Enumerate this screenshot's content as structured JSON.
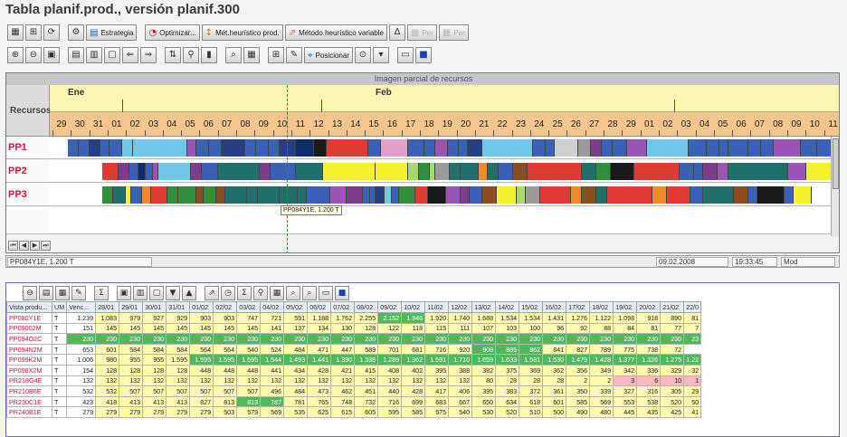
{
  "title": "Tabla planif.prod., versión planif.300",
  "toolbar1": {
    "estrategia": "Estrategia",
    "optimizar": "Optimizar...",
    "met_heur_prod": "Mét.heurístico prod.",
    "metodo_heur_var": "Método heurístico variable",
    "per1": "Per",
    "per2": "Per"
  },
  "toolbar2": {
    "posicionar": "Posicionar"
  },
  "gantt": {
    "subtitle": "Imagen parcial de recursos",
    "corner_label": "Recursos",
    "months": [
      "Ene",
      "Feb"
    ],
    "days": [
      "29",
      "30",
      "31",
      "01",
      "02",
      "03",
      "04",
      "05",
      "06",
      "07",
      "08",
      "09",
      "10",
      "11",
      "12",
      "13",
      "14",
      "15",
      "16",
      "17",
      "18",
      "19",
      "20",
      "21",
      "22",
      "23",
      "24",
      "25",
      "26",
      "27",
      "28",
      "29",
      "01",
      "02",
      "03",
      "04",
      "05",
      "06",
      "07",
      "08",
      "09",
      "10",
      "11"
    ],
    "resources": [
      "PP1",
      "PP2",
      "PP3"
    ],
    "tooltip": "PP084Y1E, 1.200 T"
  },
  "status": {
    "left": "PP084Y1E, 1.200 T",
    "date": "09.02.2008",
    "time": "19:33:45",
    "mode": "Mod"
  },
  "table": {
    "headers": [
      "Vista produ...",
      "UM",
      "Venc...",
      "28/01",
      "29/01",
      "30/01",
      "31/01",
      "01/02",
      "02/02",
      "03/02",
      "04/02",
      "05/02",
      "06/02",
      "07/02",
      "08/02",
      "09/02",
      "10/02",
      "11/02",
      "12/02",
      "13/02",
      "14/02",
      "15/02",
      "16/02",
      "17/02",
      "18/02",
      "19/02",
      "20/02",
      "21/02",
      "22/0"
    ],
    "rows": [
      {
        "name": "PP080Y1E",
        "um": "T",
        "v": [
          "1.239",
          "1.083",
          "979",
          "927",
          "929",
          "903",
          "903",
          "747",
          "721",
          "591",
          "1.188",
          "1.762",
          "2.255",
          "2.152",
          "1.946",
          "1.920",
          "1.740",
          "1.688",
          "1.534",
          "1.534",
          "1.431",
          "1.276",
          "1.122",
          "1.098",
          "918",
          "890",
          "81"
        ]
      },
      {
        "name": "PP09002M",
        "um": "T",
        "v": [
          "151",
          "145",
          "145",
          "145",
          "145",
          "145",
          "145",
          "145",
          "141",
          "137",
          "134",
          "130",
          "128",
          "122",
          "118",
          "115",
          "111",
          "107",
          "103",
          "100",
          "96",
          "92",
          "88",
          "84",
          "81",
          "77",
          "7"
        ]
      },
      {
        "name": "PP094O2C",
        "um": "T",
        "v": [
          "230",
          "230",
          "230",
          "230",
          "230",
          "230",
          "230",
          "230",
          "230",
          "230",
          "230",
          "230",
          "230",
          "230",
          "230",
          "230",
          "230",
          "230",
          "230",
          "230",
          "230",
          "230",
          "230",
          "230",
          "230",
          "230",
          "23"
        ]
      },
      {
        "name": "PP094N2M",
        "um": "T",
        "v": [
          "653",
          "601",
          "584",
          "584",
          "584",
          "564",
          "564",
          "540",
          "524",
          "484",
          "471",
          "447",
          "589",
          "701",
          "681",
          "716",
          "920",
          "908",
          "885",
          "862",
          "841",
          "827",
          "789",
          "775",
          "738",
          "72"
        ]
      },
      {
        "name": "PP099K2M",
        "um": "T",
        "v": [
          "1.006",
          "980",
          "955",
          "955",
          "1.595",
          "1.595",
          "1.595",
          "1.595",
          "1.544",
          "1.493",
          "1.441",
          "1.390",
          "1.339",
          "1.288",
          "1.362",
          "1.591",
          "1.710",
          "1.659",
          "1.633",
          "1.581",
          "1.530",
          "1.479",
          "1.428",
          "1.377",
          "1.326",
          "1.275",
          "1.22"
        ]
      },
      {
        "name": "PP098X2M",
        "um": "T",
        "v": [
          "154",
          "128",
          "128",
          "128",
          "128",
          "448",
          "448",
          "448",
          "441",
          "434",
          "428",
          "421",
          "415",
          "408",
          "402",
          "395",
          "388",
          "382",
          "375",
          "369",
          "362",
          "356",
          "349",
          "342",
          "336",
          "329",
          "32"
        ]
      },
      {
        "name": "PR218G4E",
        "um": "T",
        "v": [
          "132",
          "132",
          "132",
          "132",
          "132",
          "132",
          "132",
          "132",
          "132",
          "132",
          "132",
          "132",
          "132",
          "132",
          "132",
          "132",
          "132",
          "80",
          "28",
          "28",
          "28",
          "2",
          "2",
          "3",
          "6",
          "10",
          "1"
        ]
      },
      {
        "name": "PR210B6E",
        "um": "T",
        "v": [
          "532",
          "532",
          "507",
          "507",
          "507",
          "507",
          "507",
          "507",
          "496",
          "484",
          "473",
          "462",
          "451",
          "440",
          "428",
          "417",
          "406",
          "395",
          "383",
          "372",
          "361",
          "350",
          "339",
          "327",
          "316",
          "305",
          "29"
        ]
      },
      {
        "name": "PR230C1E",
        "um": "T",
        "v": [
          "423",
          "418",
          "413",
          "413",
          "413",
          "827",
          "813",
          "813",
          "787",
          "781",
          "765",
          "748",
          "732",
          "716",
          "699",
          "683",
          "667",
          "650",
          "634",
          "618",
          "601",
          "585",
          "569",
          "553",
          "538",
          "520",
          "50"
        ]
      },
      {
        "name": "PR240B1E",
        "um": "T",
        "v": [
          "279",
          "279",
          "279",
          "279",
          "279",
          "279",
          "503",
          "579",
          "569",
          "535",
          "625",
          "615",
          "605",
          "595",
          "585",
          "575",
          "540",
          "530",
          "520",
          "510",
          "500",
          "490",
          "480",
          "445",
          "435",
          "425",
          "41"
        ]
      }
    ]
  }
}
